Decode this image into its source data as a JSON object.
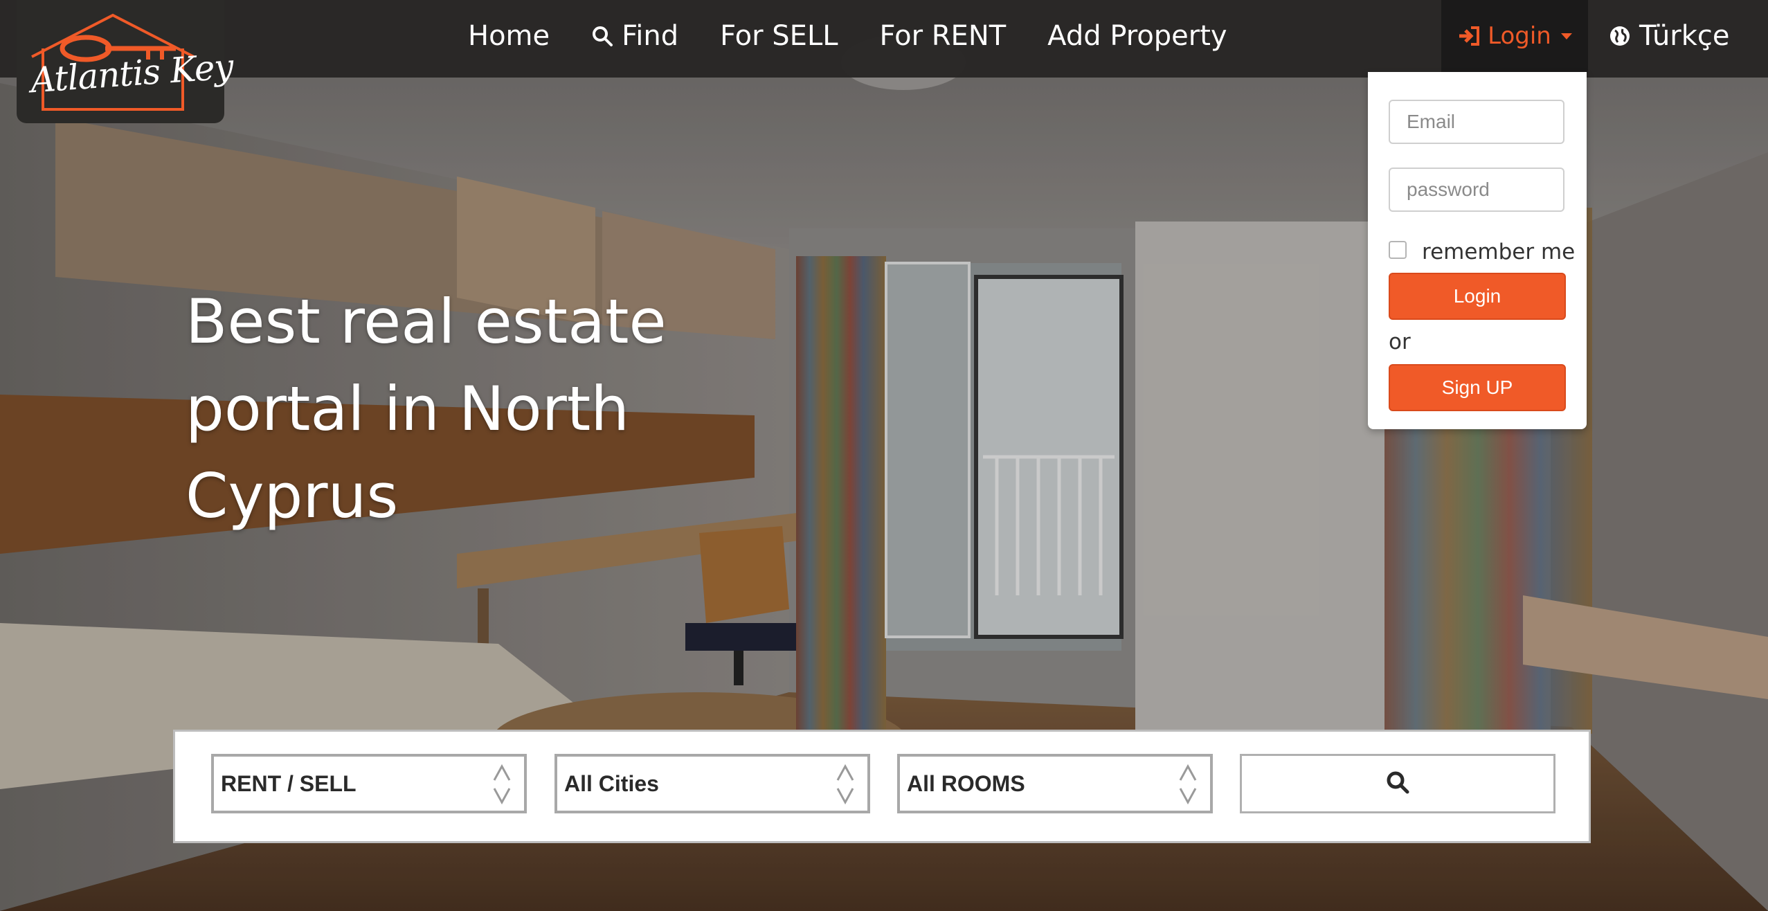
{
  "brand": {
    "logo_text": "Atlantis Key",
    "accent_color": "#f05a28"
  },
  "nav": {
    "items": [
      {
        "label": "Home"
      },
      {
        "label": "Find",
        "icon": "search-icon"
      },
      {
        "label": "For SELL"
      },
      {
        "label": "For RENT"
      },
      {
        "label": "Add Property"
      }
    ],
    "login_label": "Login",
    "login_icon": "sign-in-icon",
    "language_label": "Türkçe",
    "language_icon": "globe-icon"
  },
  "login_dropdown": {
    "email_placeholder": "Email",
    "password_placeholder": "password",
    "remember_label": "remember me",
    "login_button": "Login",
    "or_text": "or",
    "signup_button": "Sign UP"
  },
  "hero": {
    "headline": "Best real estate portal in North Cyprus"
  },
  "search": {
    "type_select": "RENT / SELL",
    "city_select": "All Cities",
    "rooms_select": "All ROOMS",
    "search_icon": "search-icon"
  }
}
